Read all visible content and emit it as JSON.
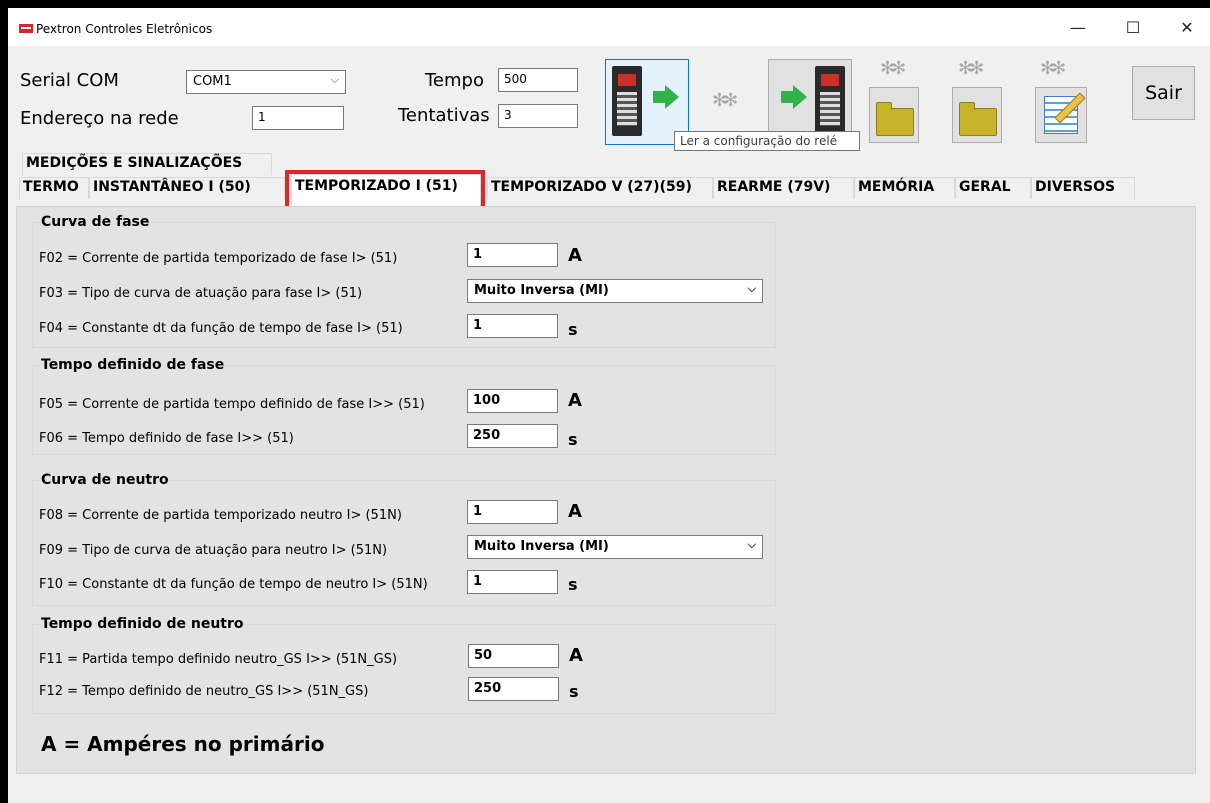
{
  "window": {
    "title": "Pextron Controles Eletrônicos"
  },
  "controls": {
    "serial_label": "Serial COM",
    "serial_value": "COM1",
    "endereco_label": "Endereço na rede",
    "endereco_value": "1",
    "tempo_label": "Tempo",
    "tempo_value": "500",
    "tentativas_label": "Tentativas",
    "tentativas_value": "3",
    "sair_label": "Sair"
  },
  "tooltip": "Ler a configuração do relé",
  "tabs_row1": [
    "MEDIÇÕES E SINALIZAÇÕES"
  ],
  "tabs_row2": [
    "TERMO",
    "INSTANTÂNEO I (50)",
    "TEMPORIZADO I (51)",
    "TEMPORIZADO V (27)(59)",
    "REARME (79V)",
    "MEMÓRIA",
    "GERAL",
    "DIVERSOS"
  ],
  "active_tab": "TEMPORIZADO I (51)",
  "groups": {
    "curva_fase": {
      "title": "Curva de fase",
      "f02_label": "F02 = Corrente de partida temporizado de fase I> (51)",
      "f02_value": "1",
      "f02_unit": "A",
      "f03_label": "F03 = Tipo de curva de atuação para fase I> (51)",
      "f03_value": "Muito Inversa (MI)",
      "f04_label": "F04 = Constante dt da função de tempo de fase I> (51)",
      "f04_value": "1",
      "f04_unit": "s"
    },
    "tempo_fase": {
      "title": "Tempo definido de fase",
      "f05_label": "F05 = Corrente de partida tempo definido de fase I>> (51)",
      "f05_value": "100",
      "f05_unit": "A",
      "f06_label": "F06 = Tempo definido de fase I>> (51)",
      "f06_value": "250",
      "f06_unit": "s"
    },
    "curva_neutro": {
      "title": "Curva de neutro",
      "f08_label": "F08 = Corrente de partida temporizado neutro I> (51N)",
      "f08_value": "1",
      "f08_unit": "A",
      "f09_label": "F09 = Tipo de curva de atuação para neutro I> (51N)",
      "f09_value": "Muito Inversa (MI)",
      "f10_label": "F10 = Constante dt da função de tempo de neutro I> (51N)",
      "f10_value": "1",
      "f10_unit": "s"
    },
    "tempo_neutro": {
      "title": "Tempo definido de neutro",
      "f11_label": "F11 = Partida tempo definido neutro_GS I>> (51N_GS)",
      "f11_value": "50",
      "f11_unit": "A",
      "f12_label": "F12 = Tempo definido de neutro_GS I>> (51N_GS)",
      "f12_value": "250",
      "f12_unit": "s"
    }
  },
  "footer_note": "A = Ampéres no primário",
  "window_buttons": {
    "minimize": "—",
    "maximize": "☐",
    "close": "✕"
  },
  "colors": {
    "highlight": "#e0262b",
    "arrow": "#2fb24a"
  }
}
